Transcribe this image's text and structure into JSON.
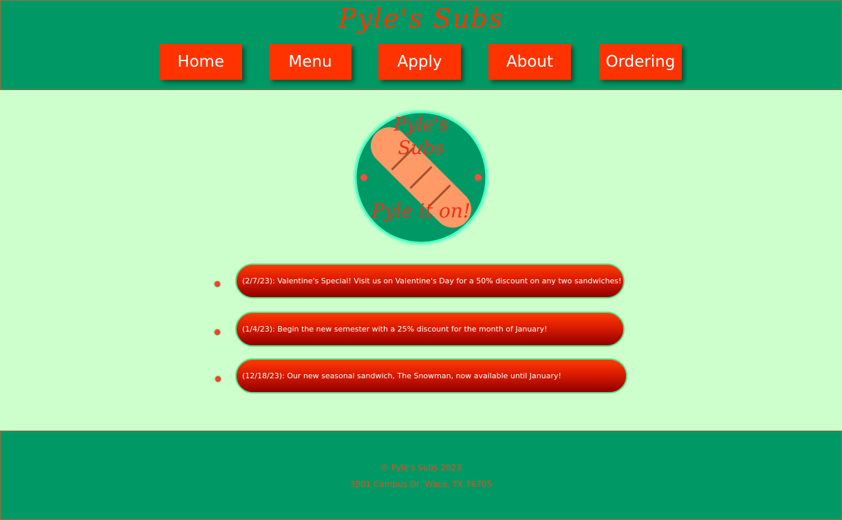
{
  "header": {
    "title": "Pyle's Subs",
    "nav": [
      {
        "label": "Home"
      },
      {
        "label": "Menu"
      },
      {
        "label": "Apply"
      },
      {
        "label": "About"
      },
      {
        "label": "Ordering"
      }
    ]
  },
  "logo": {
    "line1": "Pyle's",
    "line2": "Subs",
    "slogan": "Pyle it on!"
  },
  "news": [
    {
      "text": "(2/7/23): Valentine's Special! Visit us on Valentine's Day for a 50% discount on any two sandwiches!"
    },
    {
      "text": "(1/4/23): Begin the new semester with a 25% discount for the month of January!"
    },
    {
      "text": "(12/18/23): Our new seasonal sandwich, The Snowman, now available until January!"
    }
  ],
  "footer": {
    "copyright": "© Pyle's Subs 2023",
    "address": "3801 Campus Dr, Waco, TX 76705"
  },
  "colors": {
    "header_bg": "#009966",
    "accent": "#ff3300",
    "page_bg": "#ccffcc",
    "logo_sub": "#ff9966"
  }
}
